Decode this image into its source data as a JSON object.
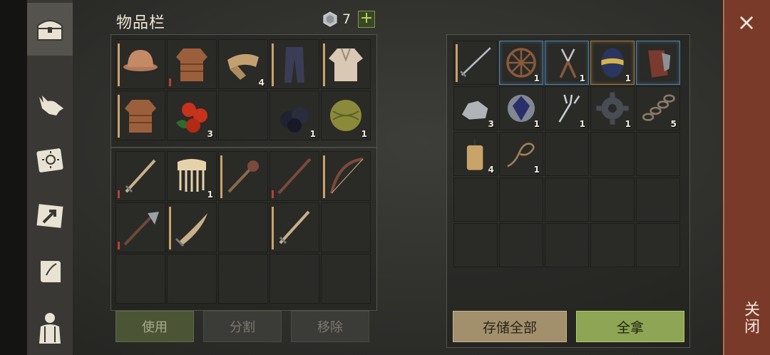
{
  "inventory": {
    "title": "物品栏",
    "currency_count": "7",
    "plus_label": "+",
    "apparel_rows": [
      [
        {
          "icon": "helmet-icon",
          "qty": "",
          "dur": "tan"
        },
        {
          "icon": "leather-armor-icon",
          "qty": "",
          "dur": "red"
        },
        {
          "icon": "scarf-icon",
          "qty": "4",
          "dur": ""
        },
        {
          "icon": "pants-icon",
          "qty": "",
          "dur": "tan"
        },
        {
          "icon": "shirt-icon",
          "qty": "",
          "dur": "tan"
        }
      ],
      [
        {
          "icon": "leather-armor-icon",
          "qty": "",
          "dur": "tan"
        },
        {
          "icon": "berries-icon",
          "qty": "3",
          "dur": ""
        },
        {
          "icon": "",
          "qty": "",
          "dur": ""
        },
        {
          "icon": "coal-icon",
          "qty": "1",
          "dur": ""
        },
        {
          "icon": "fiber-ball-icon",
          "qty": "1",
          "dur": ""
        }
      ]
    ],
    "weapon_rows": [
      [
        {
          "icon": "sword-icon",
          "qty": "",
          "dur": "red"
        },
        {
          "icon": "comb-icon",
          "qty": "1",
          "dur": ""
        },
        {
          "icon": "mace-icon",
          "qty": "",
          "dur": "tan"
        },
        {
          "icon": "spear-icon",
          "qty": "",
          "dur": "red"
        },
        {
          "icon": "bow-icon",
          "qty": "",
          "dur": "tan"
        }
      ],
      [
        {
          "icon": "halberd-icon",
          "qty": "",
          "dur": "red"
        },
        {
          "icon": "falchion-icon",
          "qty": "",
          "dur": "tan"
        },
        {
          "icon": "",
          "qty": "",
          "dur": ""
        },
        {
          "icon": "sword-icon",
          "qty": "",
          "dur": "tan"
        },
        {
          "icon": "",
          "qty": "",
          "dur": ""
        }
      ],
      [
        {
          "icon": "",
          "qty": "",
          "dur": ""
        },
        {
          "icon": "",
          "qty": "",
          "dur": ""
        },
        {
          "icon": "",
          "qty": "",
          "dur": ""
        },
        {
          "icon": "",
          "qty": "",
          "dur": ""
        },
        {
          "icon": "",
          "qty": "",
          "dur": ""
        }
      ]
    ],
    "buttons": {
      "use": "使用",
      "split": "分割",
      "remove": "移除"
    }
  },
  "container": {
    "rows": [
      [
        {
          "icon": "long-sword-icon",
          "qty": "",
          "dur": "tan",
          "frame": ""
        },
        {
          "icon": "wheel-icon",
          "qty": "1",
          "dur": "",
          "frame": "blue"
        },
        {
          "icon": "pliers-icon",
          "qty": "1",
          "dur": "",
          "frame": "blue"
        },
        {
          "icon": "egg-icon",
          "qty": "1",
          "dur": "",
          "frame": "gold"
        },
        {
          "icon": "gauntlet-icon",
          "qty": "",
          "dur": "",
          "frame": "blue"
        }
      ],
      [
        {
          "icon": "stone-icon",
          "qty": "3",
          "dur": "",
          "frame": ""
        },
        {
          "icon": "crystal-icon",
          "qty": "1",
          "dur": "",
          "frame": ""
        },
        {
          "icon": "fork-icon",
          "qty": "1",
          "dur": "",
          "frame": ""
        },
        {
          "icon": "gear-icon",
          "qty": "1",
          "dur": "",
          "frame": ""
        },
        {
          "icon": "chain-icon",
          "qty": "5",
          "dur": "",
          "frame": ""
        }
      ],
      [
        {
          "icon": "candle-icon",
          "qty": "4",
          "dur": "",
          "frame": ""
        },
        {
          "icon": "rope-icon",
          "qty": "1",
          "dur": "",
          "frame": ""
        },
        {
          "icon": "",
          "qty": "",
          "dur": "",
          "frame": ""
        },
        {
          "icon": "",
          "qty": "",
          "dur": "",
          "frame": ""
        },
        {
          "icon": "",
          "qty": "",
          "dur": "",
          "frame": ""
        }
      ],
      [
        {
          "icon": "",
          "qty": "",
          "dur": "",
          "frame": ""
        },
        {
          "icon": "",
          "qty": "",
          "dur": "",
          "frame": ""
        },
        {
          "icon": "",
          "qty": "",
          "dur": "",
          "frame": ""
        },
        {
          "icon": "",
          "qty": "",
          "dur": "",
          "frame": ""
        },
        {
          "icon": "",
          "qty": "",
          "dur": "",
          "frame": ""
        }
      ],
      [
        {
          "icon": "",
          "qty": "",
          "dur": "",
          "frame": ""
        },
        {
          "icon": "",
          "qty": "",
          "dur": "",
          "frame": ""
        },
        {
          "icon": "",
          "qty": "",
          "dur": "",
          "frame": ""
        },
        {
          "icon": "",
          "qty": "",
          "dur": "",
          "frame": ""
        },
        {
          "icon": "",
          "qty": "",
          "dur": "",
          "frame": ""
        }
      ]
    ],
    "buttons": {
      "store_all": "存储全部",
      "take_all": "全拿"
    }
  },
  "sidebar": {
    "tabs": [
      {
        "icon": "chest-icon",
        "active": true
      },
      {
        "icon": "wolf-icon",
        "active": false
      },
      {
        "icon": "sun-book-icon",
        "active": false
      },
      {
        "icon": "map-arrow-icon",
        "active": false
      },
      {
        "icon": "scroll-icon",
        "active": false
      },
      {
        "icon": "character-icon",
        "active": false
      }
    ]
  },
  "close": {
    "label": "关闭",
    "x": "×"
  },
  "colors": {
    "background": "#2f2f2c",
    "close_panel": "#7a3a2a",
    "take_all": "#8da554",
    "store_all": "#a2906c",
    "durability_tan": "#c9a26a",
    "durability_red": "#b84234",
    "rare_blue": "#4d7fa6",
    "rare_gold": "#a27a3c"
  }
}
